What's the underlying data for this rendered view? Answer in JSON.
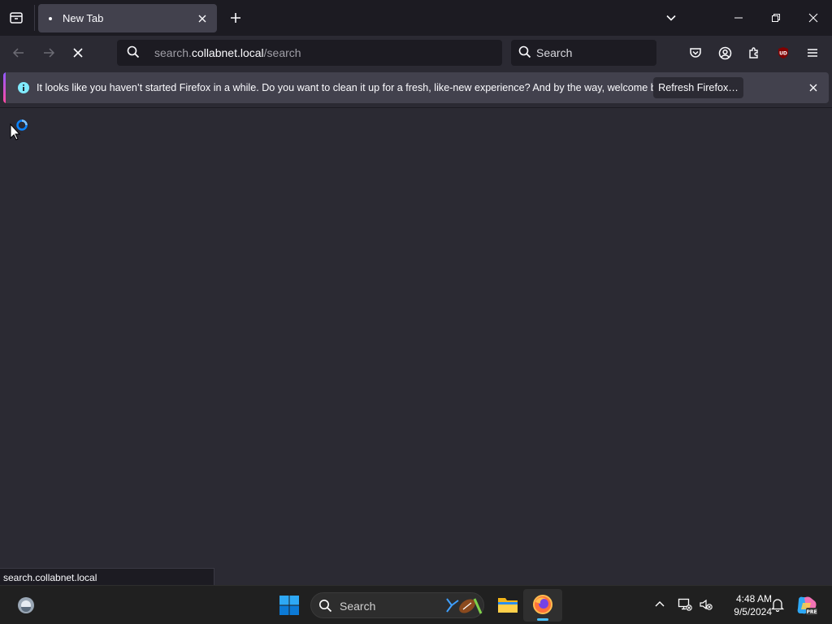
{
  "tabs": [
    {
      "title": "New Tab"
    }
  ],
  "urlbar": {
    "prefix": "search.",
    "host": "collabnet.local",
    "path": "/search"
  },
  "searchbar": {
    "placeholder": "Search"
  },
  "notification": {
    "message": "It looks like you haven’t started Firefox in a while. Do you want to clean it up for a fresh, like-new experience? And by the way, welcome back!",
    "button_label": "Refresh Firefox…"
  },
  "status_bar": {
    "text": "search.collabnet.local"
  },
  "taskbar": {
    "search_label": "Search",
    "time": "4:48 AM",
    "date": "9/5/2024"
  },
  "icons": {
    "extension_badge_text": "UD",
    "copilot_badge": "PRE"
  },
  "colors": {
    "frame": "#1c1b22",
    "toolbar": "#2b2a33",
    "accent": "#0df",
    "loading_spinner": "#0a84ff",
    "active_app_indicator": "#4cc2ff"
  }
}
